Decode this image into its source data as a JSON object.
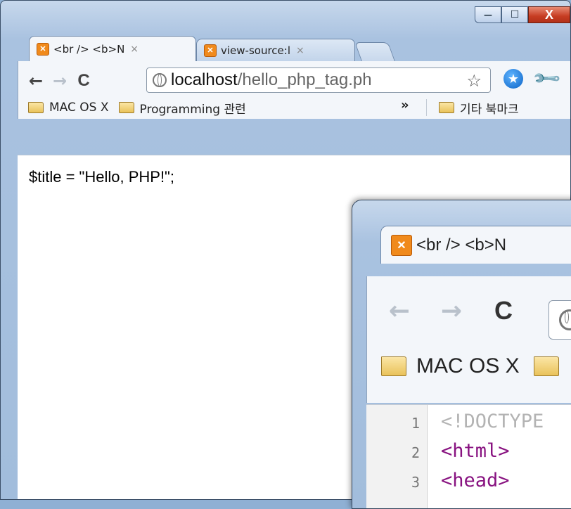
{
  "window1": {
    "tabs": [
      {
        "label": "<br /> <b>N",
        "close": "×",
        "favicon": "xampp"
      },
      {
        "label": "view-source:l",
        "close": "×",
        "favicon": "xampp"
      }
    ],
    "controls": {
      "minimize": "—",
      "maximize": "☐",
      "close": "X"
    },
    "address": {
      "host": "localhost",
      "path": "/hello_php_tag.ph"
    },
    "icons": {
      "back": "←",
      "forward": "→",
      "reload": "C",
      "star": "☆",
      "extension": "★",
      "wrench": "🔧"
    },
    "bookmarks": [
      {
        "label": "MAC OS X"
      },
      {
        "label": "Programming 관련"
      }
    ],
    "bookmarks_overflow": "»",
    "other_bookmarks": "기타 북마크",
    "content_text": "$title = \"Hello, PHP!\";"
  },
  "window2": {
    "tab_label": "<br /> <b>N",
    "icons": {
      "back": "←",
      "forward": "→",
      "reload": "C"
    },
    "bookmark": "MAC OS X",
    "source_lines": [
      {
        "num": "1",
        "code": "<!DOCTYPE"
      },
      {
        "num": "2",
        "code": "<html>"
      },
      {
        "num": "3",
        "code": "<head>"
      }
    ]
  }
}
